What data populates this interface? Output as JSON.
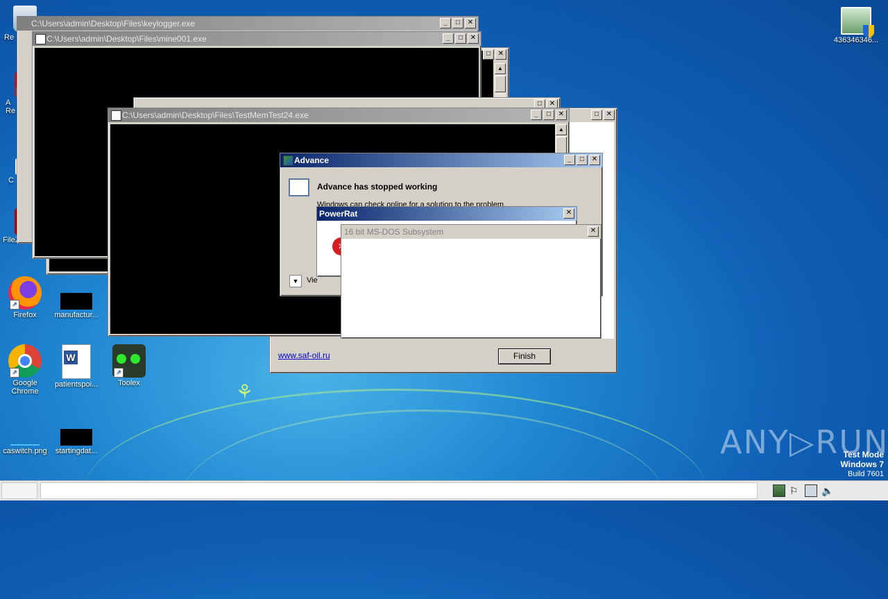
{
  "desktop": {
    "icons": [
      {
        "id": "recycle",
        "label": "Re"
      },
      {
        "id": "acrobat",
        "label": "A\nRe"
      },
      {
        "id": "cc",
        "label": "C"
      },
      {
        "id": "filezilla",
        "label": "FileZilla C"
      },
      {
        "id": "firefox",
        "label": "Firefox"
      },
      {
        "id": "manufactur",
        "label": "manufactur..."
      },
      {
        "id": "chrome",
        "label": "Google\nChrome"
      },
      {
        "id": "patientspoi",
        "label": "patientspoi..."
      },
      {
        "id": "toolex",
        "label": "Toolex"
      },
      {
        "id": "caswitch",
        "label": "caswitch.png"
      },
      {
        "id": "startingdat",
        "label": "startingdat..."
      },
      {
        "id": "netfile",
        "label": "436346346..."
      }
    ],
    "watermark": "ANY▷RUN",
    "testmode": {
      "line1": "Test Mode",
      "line2": "Windows 7",
      "line3": "Build 7601"
    }
  },
  "windows": {
    "keylogger": {
      "title": "C:\\Users\\admin\\Desktop\\Files\\keylogger.exe"
    },
    "mine": {
      "title": "C:\\Users\\admin\\Desktop\\Files\\mine001.exe"
    },
    "memtest": {
      "title": "C:\\Users\\admin\\Desktop\\Files\\TestMemTest24.exe"
    },
    "advance": {
      "title": "Advance",
      "heading": "Advance has stopped working",
      "body": "Windows can check online for a solution to the problem.",
      "view": "Vie"
    },
    "powerrat": {
      "title": "PowerRat"
    },
    "dos": {
      "title": "16 bit MS-DOS Subsystem"
    },
    "installer": {
      "link": "www.saf-oil.ru",
      "finish": "Finish"
    }
  },
  "titlebar_buttons": {
    "min": "_",
    "max": "□",
    "close": "✕"
  }
}
